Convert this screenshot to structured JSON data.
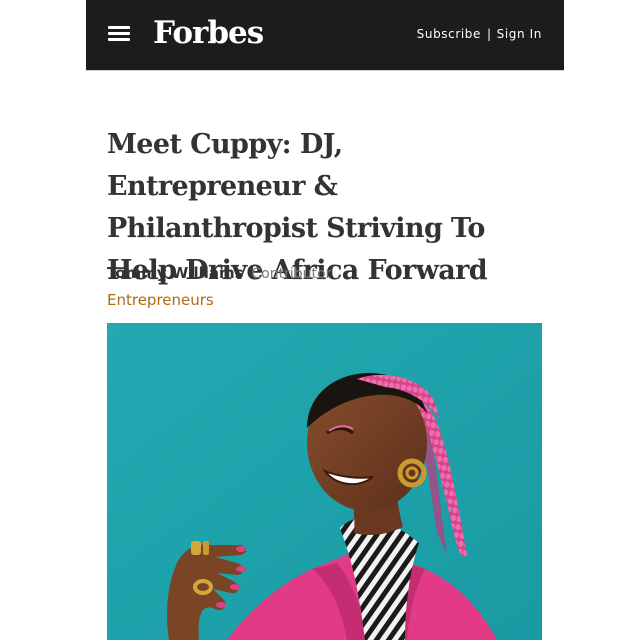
{
  "header": {
    "logo": "Forbes",
    "subscribe_label": "Subscribe",
    "separator": "|",
    "sign_in_label": "Sign In",
    "menu_icon": "hamburger-menu-icon"
  },
  "article": {
    "headline": "Meet Cuppy: DJ, Entrepreneur & Philanthropist Striving To Help Drive Africa Forward",
    "author": "Tommy Williams",
    "author_role": "Contributor",
    "channel": "Entrepreneurs"
  },
  "colors": {
    "header_bg": "#1d1b1b",
    "channel_link": "#b06a14",
    "hero_bg": "#1fa6ae",
    "blazer": "#e23a86",
    "braids": "#d9438c"
  }
}
